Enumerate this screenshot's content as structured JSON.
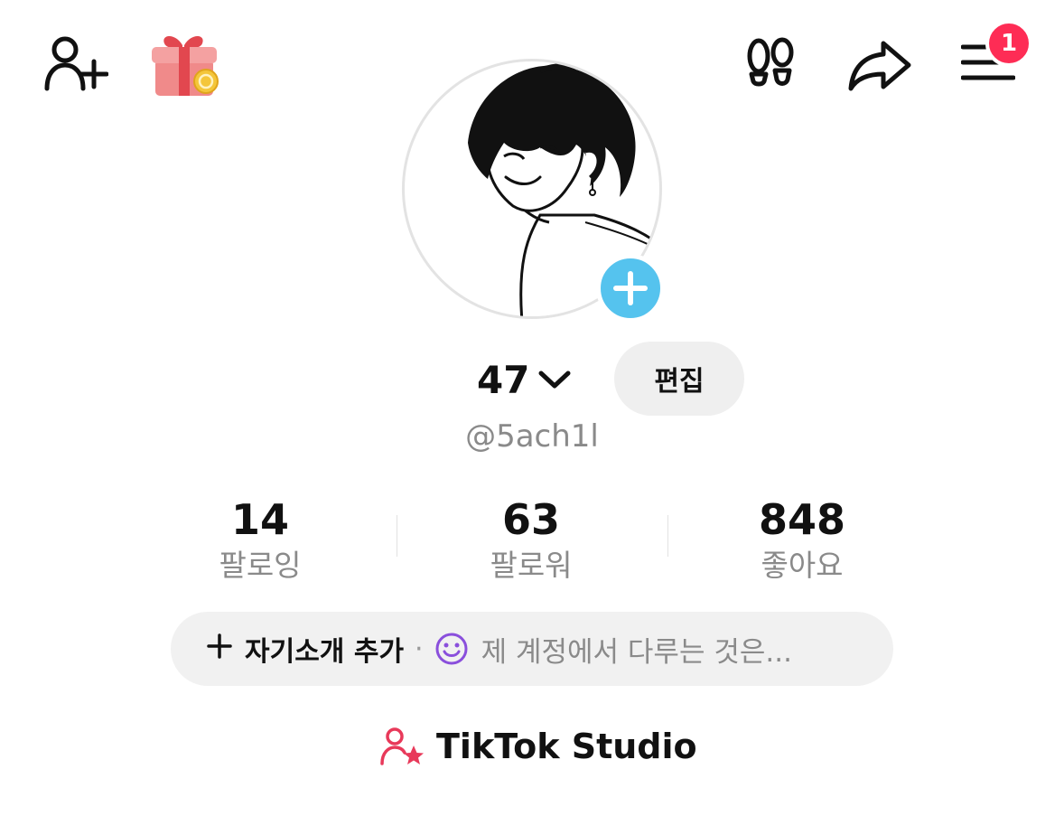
{
  "header": {
    "icons": [
      "add-friend-icon",
      "gift-icon",
      "footprints-icon",
      "share-icon",
      "menu-icon"
    ],
    "menu_badge": "1"
  },
  "profile": {
    "display_name": "47",
    "username": "@5ach1l",
    "edit_label": "편집"
  },
  "stats": [
    {
      "value": "14",
      "label": "팔로잉"
    },
    {
      "value": "63",
      "label": "팔로워"
    },
    {
      "value": "848",
      "label": "좋아요"
    }
  ],
  "bio": {
    "add_label": "자기소개 추가",
    "separator": "·",
    "hint": "제 계정에서 다루는 것은..."
  },
  "studio": {
    "label": "TikTok Studio"
  },
  "colors": {
    "badge": "#fe2c55",
    "avatar_add": "#55c3ee",
    "studio_icon": "#e8395a",
    "smile_icon": "#8a4fdc"
  }
}
